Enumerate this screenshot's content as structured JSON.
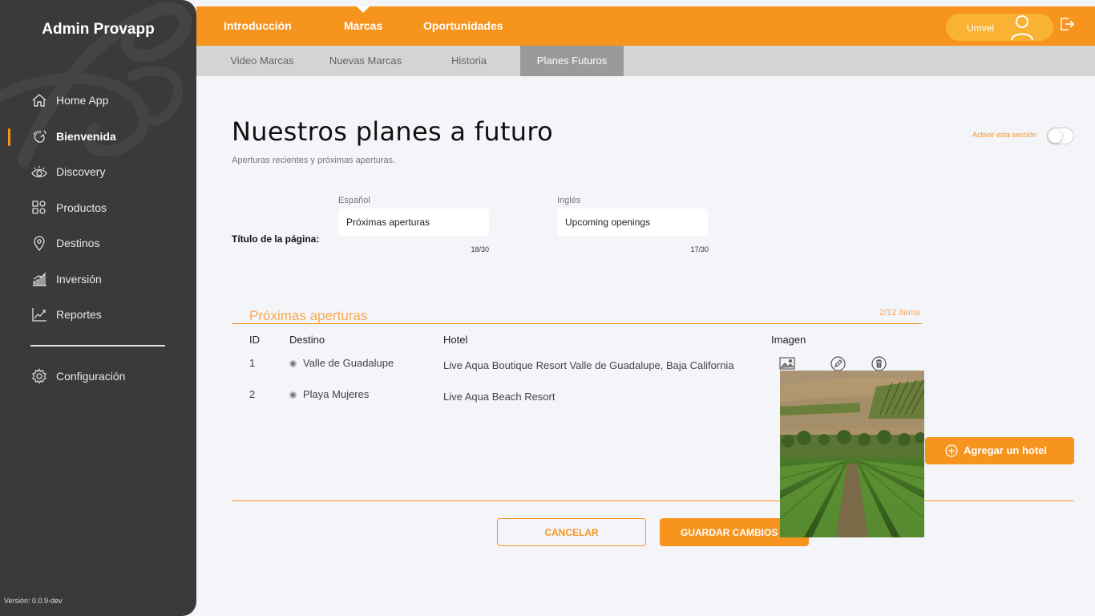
{
  "app": {
    "title": "Admin Provapp",
    "version": "Versión: 0.0.9-dev"
  },
  "sidebar": {
    "items": [
      {
        "label": "Home App",
        "icon": "home-icon"
      },
      {
        "label": "Bienvenida",
        "icon": "wave-hand-icon",
        "active": true
      },
      {
        "label": "Discovery",
        "icon": "eye-icon"
      },
      {
        "label": "Productos",
        "icon": "grid-shapes-icon"
      },
      {
        "label": "Destinos",
        "icon": "map-pin-icon"
      },
      {
        "label": "Inversión",
        "icon": "bar-growth-icon"
      },
      {
        "label": "Reportes",
        "icon": "line-chart-icon"
      }
    ],
    "config": {
      "label": "Configuración",
      "icon": "gear-icon"
    }
  },
  "topbar": {
    "tabs": [
      {
        "label": "Introducción"
      },
      {
        "label": "Marcas",
        "active": true
      },
      {
        "label": "Oportunidades"
      }
    ],
    "user_name": "Umvel"
  },
  "subtabs": [
    {
      "label": "Video Marcas"
    },
    {
      "label": "Nuevas Marcas"
    },
    {
      "label": "Historia"
    },
    {
      "label": "Planes Futuros",
      "active": true
    }
  ],
  "page": {
    "title": "Nuestros planes a futuro",
    "subtitle": "Aperturas recientes y próximas aperturas.",
    "activate_label": "Activar esta sección",
    "activate_on": false
  },
  "form": {
    "title_label": "Título de la página:",
    "spanish": {
      "label": "Español",
      "value": "Próximas aperturas",
      "counter": "18/30"
    },
    "english": {
      "label": "Inglés",
      "value": "Upcoming openings",
      "counter": "17/30"
    }
  },
  "section": {
    "title": "Próximas aperturas",
    "count": "2/12 items",
    "columns": {
      "id": "ID",
      "destino": "Destino",
      "hotel": "Hotel",
      "imagen": "Imagen"
    },
    "rows": [
      {
        "id": "1",
        "destino": "Valle de Guadalupe",
        "hotel": "Live Aqua Boutique Resort Valle de Guadalupe, Baja California"
      },
      {
        "id": "2",
        "destino": "Playa Mujeres",
        "hotel": "Live Aqua Beach Resort"
      }
    ],
    "add_label": "Agregar un hotel"
  },
  "actions": {
    "cancel": "CANCELAR",
    "save": "GUARDAR CAMBIOS"
  },
  "colors": {
    "accent": "#f7941d",
    "sidebar_bg": "#3a3a3a",
    "subtab_active": "#9a9a9a"
  }
}
